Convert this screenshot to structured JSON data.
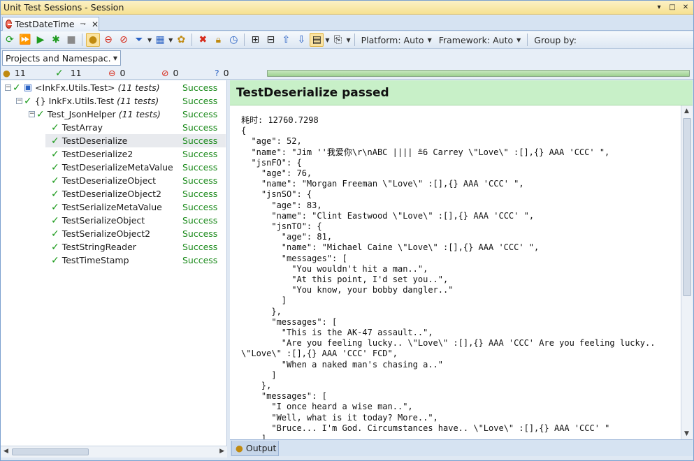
{
  "window": {
    "title": "Unit Test Sessions - Session",
    "controls": [
      "▾",
      "□",
      "✕"
    ]
  },
  "tab": {
    "label": "TestDateTime",
    "pin": "⇁",
    "close": "✕"
  },
  "toolbar": {
    "platform_label": "Platform: Auto",
    "framework_label": "Framework: Auto",
    "group_by_label": "Group by:"
  },
  "grouping": {
    "selected": "Projects and Namespac..."
  },
  "counters": {
    "total": "11",
    "passed": "11",
    "failed": "0",
    "ignored": "0",
    "unknown": "0",
    "progress": 1.0
  },
  "tree": {
    "project": {
      "label": "<InkFx.Utils.Test>",
      "count": "(11 tests)",
      "status": "Success"
    },
    "namespace": {
      "label": "InkFx.Utils.Test",
      "count": "(11 tests)",
      "status": "Success"
    },
    "fixture": {
      "label": "Test_JsonHelper",
      "count": "(11 tests)",
      "status": "Success"
    },
    "tests": [
      {
        "label": "TestArray",
        "status": "Success"
      },
      {
        "label": "TestDeserialize",
        "status": "Success"
      },
      {
        "label": "TestDeserialize2",
        "status": "Success"
      },
      {
        "label": "TestDeserializeMetaValue",
        "status": "Success"
      },
      {
        "label": "TestDeserializeObject",
        "status": "Success"
      },
      {
        "label": "TestDeserializeObject2",
        "status": "Success"
      },
      {
        "label": "TestSerializeMetaValue",
        "status": "Success"
      },
      {
        "label": "TestSerializeObject",
        "status": "Success"
      },
      {
        "label": "TestSerializeObject2",
        "status": "Success"
      },
      {
        "label": "TestStringReader",
        "status": "Success"
      },
      {
        "label": "TestTimeStamp",
        "status": "Success"
      }
    ]
  },
  "result": {
    "header": "TestDeserialize passed",
    "output": "耗时: 12760.7298\n{\n  \"age\": 52,\n  \"name\": \"Jim ''我爱你\\r\\nABC |||| ≗6 Carrey \\\"Love\\\" :[],{} AAA 'CCC' \",\n  \"jsnFO\": {\n    \"age\": 76,\n    \"name\": \"Morgan Freeman \\\"Love\\\" :[],{} AAA 'CCC' \",\n    \"jsnSO\": {\n      \"age\": 83,\n      \"name\": \"Clint Eastwood \\\"Love\\\" :[],{} AAA 'CCC' \",\n      \"jsnTO\": {\n        \"age\": 81,\n        \"name\": \"Michael Caine \\\"Love\\\" :[],{} AAA 'CCC' \",\n        \"messages\": [\n          \"You wouldn't hit a man..\",\n          \"At this point, I'd set you..\",\n          \"You know, your bobby dangler..\"\n        ]\n      },\n      \"messages\": [\n        \"This is the AK-47 assault..\",\n        \"Are you feeling lucky.. \\\"Love\\\" :[],{} AAA 'CCC' Are you feeling lucky..\n\\\"Love\\\" :[],{} AAA 'CCC' FCD\",\n        \"When a naked man's chasing a..\"\n      ]\n    },\n    \"messages\": [\n      \"I once heard a wise man..\",\n      \"Well, what is it today? More..\",\n      \"Bruce... I'm God. Circumstances have.. \\\"Love\\\" :[],{} AAA 'CCC' \"\n    ]",
    "output_tab": "Output"
  }
}
